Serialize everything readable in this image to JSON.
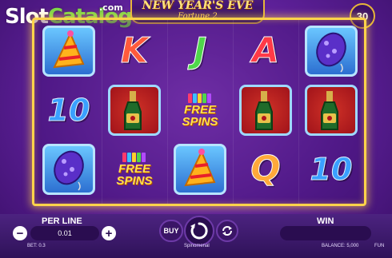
{
  "watermark": {
    "slot": "Slot",
    "catalog": "Catalog",
    "com": ".com"
  },
  "game": {
    "title_line1": "NEW YEAR'S EVE",
    "title_line2": "Fortune 2",
    "lines": "30"
  },
  "reels": [
    [
      {
        "symbol": "party-hat",
        "kind": "hat"
      },
      {
        "symbol": "10",
        "kind": "num"
      },
      {
        "symbol": "balloon",
        "kind": "balloon"
      }
    ],
    [
      {
        "symbol": "K",
        "kind": "k"
      },
      {
        "symbol": "champagne",
        "kind": "champagne"
      },
      {
        "symbol": "free-spins",
        "kind": "free",
        "line1": "FREE",
        "line2": "SPINS"
      }
    ],
    [
      {
        "symbol": "J",
        "kind": "j"
      },
      {
        "symbol": "free-spins",
        "kind": "free",
        "line1": "FREE",
        "line2": "SPINS"
      },
      {
        "symbol": "party-hat",
        "kind": "hat"
      }
    ],
    [
      {
        "symbol": "A",
        "kind": "a"
      },
      {
        "symbol": "champagne",
        "kind": "champagne"
      },
      {
        "symbol": "Q",
        "kind": "q"
      }
    ],
    [
      {
        "symbol": "balloon",
        "kind": "balloon"
      },
      {
        "symbol": "champagne",
        "kind": "champagne"
      },
      {
        "symbol": "10",
        "kind": "num"
      }
    ]
  ],
  "controls": {
    "per_line_label": "PER LINE",
    "bet_value": "0.01",
    "minus": "−",
    "plus": "+",
    "buy_label": "BUY",
    "win_label": "WIN"
  },
  "status_bar": {
    "bet": "BET: 0.3",
    "provider": "Spinomenal",
    "balance": "BALANCE: 5,000",
    "mode": "FUN"
  },
  "colors": {
    "frame": "#ffd34a",
    "background": "#5b1f96",
    "accent": "#6e3aa8"
  }
}
